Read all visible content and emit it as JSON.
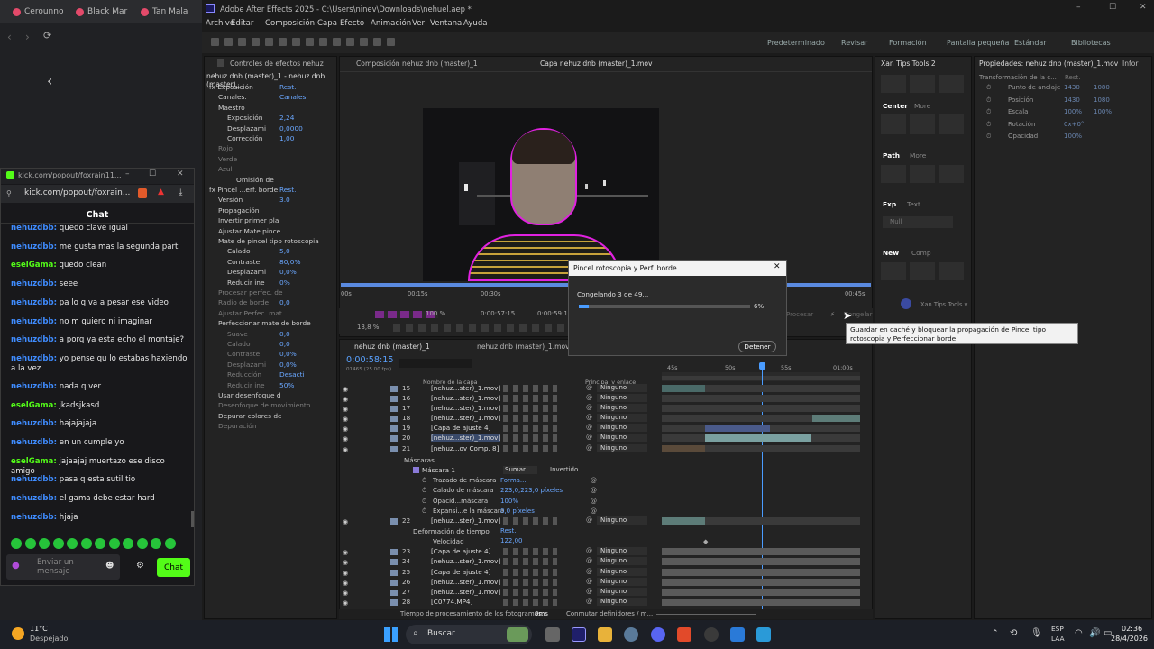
{
  "browser": {
    "tabs": [
      "Cerounno",
      "Black Mar",
      "Tan Mala"
    ],
    "popup_title": "kick.com/popout/foxrain11...",
    "popup_url": "kick.com/popout/foxrain...",
    "chat_header": "Chat",
    "chat": [
      {
        "user": "nehuzdbb:",
        "text": " quedo clave igual"
      },
      {
        "user": "nehuzdbb:",
        "text": " me gusta mas la segunda part"
      },
      {
        "user": "eselGama:",
        "text": " quedo clean"
      },
      {
        "user": "nehuzdbb:",
        "text": " seee"
      },
      {
        "user": "nehuzdbb:",
        "text": " pa lo q va a pesar ese video"
      },
      {
        "user": "nehuzdbb:",
        "text": " no m quiero ni imaginar"
      },
      {
        "user": "nehuzdbb:",
        "text": " a porq ya esta echo el montaje?"
      },
      {
        "user": "nehuzdbb:",
        "text": " yo pense qu lo estabas haxiendo a la vez"
      },
      {
        "user": "nehuzdbb:",
        "text": " nada q ver"
      },
      {
        "user": "eselGama:",
        "text": " jkadsjkasd"
      },
      {
        "user": "nehuzdbb:",
        "text": " hajajajaja"
      },
      {
        "user": "nehuzdbb:",
        "text": " en un cumple yo"
      },
      {
        "user": "eselGama:",
        "text": " jajaajaj muertazo ese disco amigo"
      },
      {
        "user": "nehuzdbb:",
        "text": " pasa q esta sutil tio"
      },
      {
        "user": "nehuzdbb:",
        "text": " el gama debe estar hard"
      },
      {
        "user": "nehuzdbb:",
        "text": " hjaja"
      }
    ],
    "send_placeholder": "Enviar un mensaje",
    "chat_button": "Chat"
  },
  "ae": {
    "title": "Adobe After Effects 2025 - C:\\Users\\ninev\\Downloads\\nehuel.aep *",
    "menu": [
      "Archivo",
      "Editar",
      "Composición",
      "Capa",
      "Efecto",
      "Animación",
      "Ver",
      "Ventana",
      "Ayuda"
    ],
    "workspaces": [
      "Predeterminado",
      "Revisar",
      "Formación",
      "Pantalla pequeña",
      "Estándar",
      "Bibliotecas"
    ],
    "effects_tab": "Controles de efectos nehuz",
    "comp_tab": "Composición nehuz dnb (master)_1",
    "layer_tab": "Capa nehuz dnb (master)_1.mov",
    "effects_header": "nehuz dnb (master)_1 - nehuz dnb (master)_",
    "effects": [
      {
        "label": "fx  Exposición",
        "value": "Rest.",
        "indent": 0
      },
      {
        "label": "Canales:",
        "value": "Canales",
        "indent": 1
      },
      {
        "label": "Maestro",
        "value": "",
        "indent": 1
      },
      {
        "label": "Exposición",
        "value": "2,24",
        "indent": 2
      },
      {
        "label": "Desplazami",
        "value": "0,0000",
        "indent": 2
      },
      {
        "label": "Corrección",
        "value": "1,00",
        "indent": 2
      },
      {
        "label": "Rojo",
        "value": "",
        "indent": 1
      },
      {
        "label": "Verde",
        "value": "",
        "indent": 1
      },
      {
        "label": "Azul",
        "value": "",
        "indent": 1
      },
      {
        "label": "Omisión de",
        "value": "",
        "indent": 3
      },
      {
        "label": "fx  Pincel ...erf. borde",
        "value": "Rest.",
        "indent": 0
      },
      {
        "label": "Versión",
        "value": "3.0",
        "indent": 1
      },
      {
        "label": "Propagación",
        "value": "",
        "indent": 1
      },
      {
        "label": "Invertir primer pla",
        "value": "",
        "indent": 1
      },
      {
        "label": "Ajustar Mate pince",
        "value": "",
        "indent": 1
      },
      {
        "label": "Mate de pincel tipo rotoscopia",
        "value": "",
        "indent": 1
      },
      {
        "label": "Calado",
        "value": "5,0",
        "indent": 2
      },
      {
        "label": "Contraste",
        "value": "80,0%",
        "indent": 2
      },
      {
        "label": "Desplazami",
        "value": "0,0%",
        "indent": 2
      },
      {
        "label": "Reducir ine",
        "value": "0%",
        "indent": 2
      },
      {
        "label": "Procesar perfec. de",
        "value": "",
        "indent": 1
      },
      {
        "label": "Radio de borde",
        "value": "0,0",
        "indent": 1
      },
      {
        "label": "Ajustar Perfec. mat",
        "value": "",
        "indent": 1
      },
      {
        "label": "Perfeccionar mate de borde",
        "value": "",
        "indent": 1
      },
      {
        "label": "Suave",
        "value": "0,0",
        "indent": 2
      },
      {
        "label": "Calado",
        "value": "0,0",
        "indent": 2
      },
      {
        "label": "Contraste",
        "value": "0,0%",
        "indent": 2
      },
      {
        "label": "Desplazami",
        "value": "0,0%",
        "indent": 2
      },
      {
        "label": "Reducción",
        "value": "Desacti",
        "indent": 2
      },
      {
        "label": "Reducir ine",
        "value": "50%",
        "indent": 2
      },
      {
        "label": "Usar desenfoque d",
        "value": "",
        "indent": 1
      },
      {
        "label": "Desenfoque de movimiento",
        "value": "",
        "indent": 1
      },
      {
        "label": "Depurar colores de",
        "value": "",
        "indent": 1
      },
      {
        "label": "Depuración",
        "value": "",
        "indent": 1
      }
    ],
    "ruler": [
      "00s",
      "00:15s",
      "00:30s",
      "00:45s"
    ],
    "viewer_zoom": "100 %",
    "viewer_time1": "0:00:57:15",
    "viewer_time2": "0:00:59:1",
    "viewer_zoom2": "13,8 %",
    "timeline_tab1": "nehuz dnb (master)_1",
    "timeline_tab2": "nehuz dnb (master)_1.mov Co",
    "timecode": "0:00:58:15",
    "timecode_sub": "01465 (25.00 fps)",
    "col_name": "Nombre de la capa",
    "col_parent": "Principal y enlace",
    "timeline_ruler": [
      "45s",
      "50s",
      "55s",
      "01:00s"
    ],
    "layers": [
      {
        "num": "15",
        "name": "[nehuz...ster)_1.mov]",
        "parent": "Ninguno"
      },
      {
        "num": "16",
        "name": "[nehuz...ster)_1.mov]",
        "parent": "Ninguno"
      },
      {
        "num": "17",
        "name": "[nehuz...ster)_1.mov]",
        "parent": "Ninguno"
      },
      {
        "num": "18",
        "name": "[nehuz...ster)_1.mov]",
        "parent": "Ninguno"
      },
      {
        "num": "19",
        "name": "[Capa de ajuste 4]",
        "parent": "Ninguno"
      },
      {
        "num": "20",
        "name": "[nehuz...ster)_1.mov]",
        "parent": "Ninguno"
      },
      {
        "num": "21",
        "name": "[nehuz...ov Comp. 8]",
        "parent": "Ninguno"
      }
    ],
    "mask_group": "Máscaras",
    "mask_name": "Máscara 1",
    "mask_mode": "Sumar",
    "mask_inverted": "Invertido",
    "mask_props": [
      {
        "label": "Trazado de máscara",
        "value": "Forma..."
      },
      {
        "label": "Calado de máscara",
        "value": "223,0,223,0 píxeles"
      },
      {
        "label": "Opacid...máscara",
        "value": "100%"
      },
      {
        "label": "Expansi...e la máscara",
        "value": "0,0 píxeles"
      }
    ],
    "layer22": {
      "num": "22",
      "name": "[nehuz...ster)_1.mov]",
      "parent": "Ninguno"
    },
    "time_warp": "Deformación de tiempo",
    "time_warp_value": "Rest.",
    "speed": "Velocidad",
    "speed_value": "122,00",
    "layers2": [
      {
        "num": "23",
        "name": "[Capa de ajuste 4]",
        "parent": "Ninguno"
      },
      {
        "num": "24",
        "name": "[nehuz...ster)_1.mov]",
        "parent": "Ninguno"
      },
      {
        "num": "25",
        "name": "[Capa de ajuste 4]",
        "parent": "Ninguno"
      },
      {
        "num": "26",
        "name": "[nehuz...ster)_1.mov]",
        "parent": "Ninguno"
      },
      {
        "num": "27",
        "name": "[nehuz...ster)_1.mov]",
        "parent": "Ninguno"
      },
      {
        "num": "28",
        "name": "[C0774.MP4]",
        "parent": "Ninguno"
      }
    ],
    "footer_time": "Tiempo de procesamiento de los fotogramas:",
    "footer_ms": "0ms",
    "footer_switch": "Conmutar definidores / m...",
    "dialog": {
      "title": "Pincel rotoscopia y Perf. borde",
      "status": "Congelando 3 de 49...",
      "percent": "6%",
      "progress": 0.06,
      "stop": "Detener"
    },
    "behind_dialog": {
      "process": "Procesar",
      "freeze": "Congelar"
    },
    "tooltip": "Guardar en caché y bloquear la propagación de Pincel tipo rotoscopia y Perfeccionar borde",
    "tips": {
      "tab": "Xan Tips Tools 2",
      "center": "Center",
      "more1": "More",
      "path": "Path",
      "more2": "More",
      "exp": "Exp",
      "text": "Text",
      "null": "Null",
      "new": "New",
      "comp": "Comp",
      "footer": "Xan Tips Tools v"
    },
    "props": {
      "tab": "Propiedades: nehuz dnb (master)_1.mov",
      "info": "Infor",
      "section": "Transformación de la c...",
      "reset": "Rest.",
      "items": [
        {
          "label": "Punto de anclaje",
          "v1": "1430",
          "v2": "1080"
        },
        {
          "label": "Posición",
          "v1": "1430",
          "v2": "1080"
        },
        {
          "label": "Escala",
          "v1": "100%",
          "v2": "100%"
        },
        {
          "label": "Rotación",
          "v1": "0x+0°",
          "v2": ""
        },
        {
          "label": "Opacidad",
          "v1": "100%",
          "v2": ""
        }
      ]
    }
  },
  "taskbar": {
    "weather_temp": "11°C",
    "weather_desc": "Despejado",
    "search": "Buscar",
    "lang1": "ESP",
    "lang2": "LAA",
    "time": "02:36",
    "date": "28/4/2026"
  }
}
